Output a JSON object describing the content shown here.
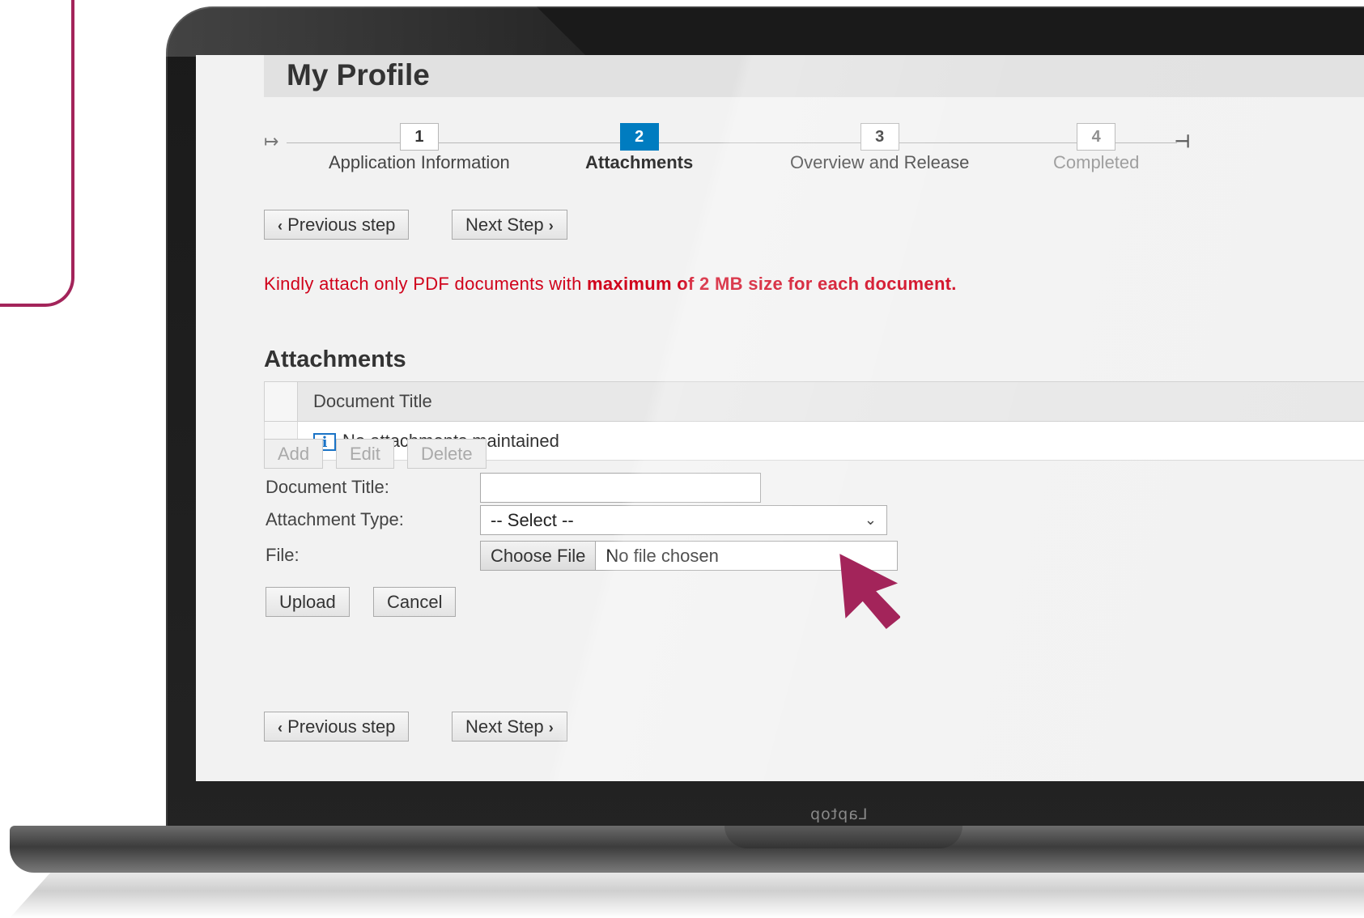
{
  "page": {
    "title": "My Profile"
  },
  "roadmap": {
    "steps": [
      {
        "number": "1",
        "label": "Application Information",
        "state": "done"
      },
      {
        "number": "2",
        "label": "Attachments",
        "state": "active"
      },
      {
        "number": "3",
        "label": "Overview and Release",
        "state": "pending"
      },
      {
        "number": "4",
        "label": "Completed",
        "state": "disabled"
      }
    ]
  },
  "nav_top": {
    "previous_label": "Previous step",
    "next_label": "Next Step"
  },
  "notice": {
    "part1": "Kindly attach only PDF documents with ",
    "part2": "maximum of 2 MB size for each document."
  },
  "attachments": {
    "section_title": "Attachments",
    "columns": [
      "Document Title"
    ],
    "empty_message": "No attachments maintained",
    "toolbar": {
      "add_label": "Add",
      "edit_label": "Edit",
      "delete_label": "Delete"
    }
  },
  "form": {
    "document_title_label": "Document Title:",
    "document_title_value": "",
    "attachment_type_label": "Attachment Type:",
    "attachment_type_value": "-- Select --",
    "file_label": "File:",
    "choose_file_label": "Choose File",
    "file_status": "No file chosen",
    "upload_label": "Upload",
    "cancel_label": "Cancel"
  },
  "nav_bottom": {
    "previous_label": "Previous step",
    "next_label": "Next Step"
  },
  "device": {
    "brand_label": "Laptop"
  },
  "colors": {
    "accent": "#a3245a",
    "active_step": "#007cc0",
    "notice": "#d0021b"
  }
}
